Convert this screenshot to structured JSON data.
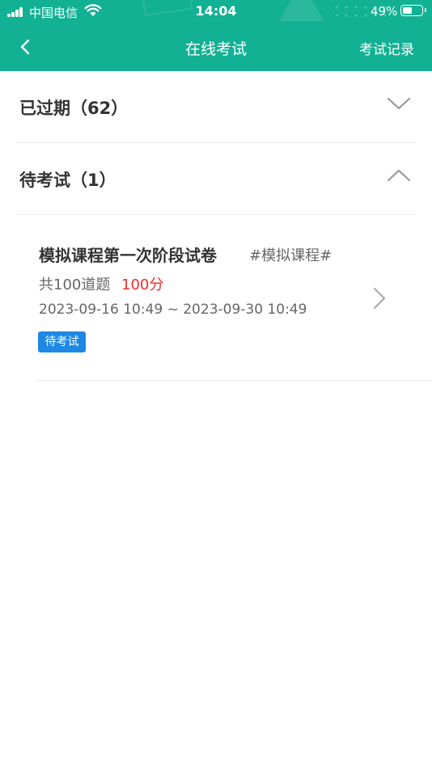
{
  "status_bar": {
    "carrier": "中国电信",
    "time": "14:04",
    "battery_percent": "49%",
    "battery_level": 0.49,
    "signal_icon": "signal-bars-icon",
    "wifi_icon": "wifi-icon",
    "battery_icon": "battery-icon"
  },
  "navbar": {
    "title": "在线考试",
    "right_action": "考试记录",
    "back_icon": "chevron-left-icon",
    "background_color": "#13b193"
  },
  "sections": [
    {
      "title": "已过期（62）",
      "state": "collapsed",
      "chevron_icon": "chevron-down-icon"
    },
    {
      "title": "待考试（1）",
      "state": "expanded",
      "chevron_icon": "chevron-up-icon"
    }
  ],
  "exams": [
    {
      "name": "模拟课程第一次阶段试卷",
      "course_tag": "#模拟课程#",
      "question_count": "共100道题",
      "total_score": "100分",
      "time_range": "2023-09-16 10:49 ~ 2023-09-30 10:49",
      "status_badge": "待考试",
      "arrow_icon": "chevron-right-icon"
    }
  ],
  "colors": {
    "accent": "#13b193",
    "score": "#f32b2b",
    "badge": "#1e88e5",
    "title_text": "#333333",
    "secondary_text": "#666666"
  }
}
